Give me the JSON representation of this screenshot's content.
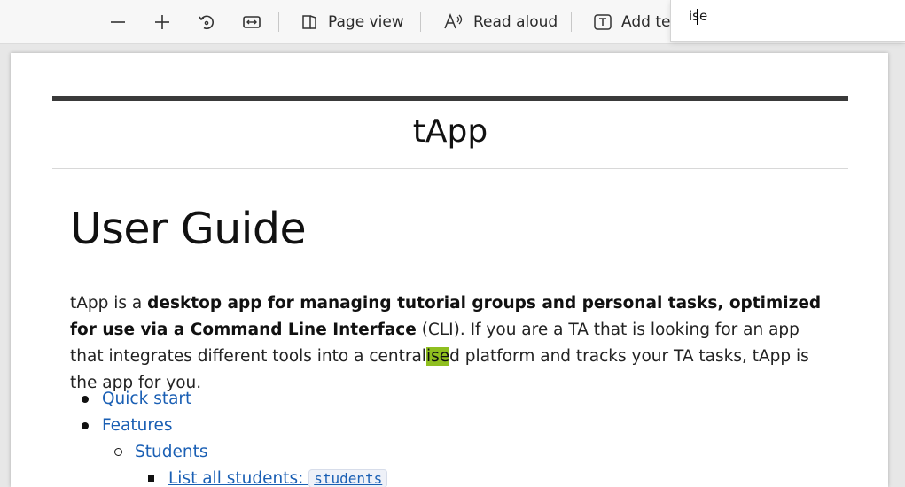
{
  "toolbar": {
    "zoom_out_icon": "minus-icon",
    "zoom_in_icon": "plus-icon",
    "rotate_icon": "rotate-icon",
    "fit_width_icon": "fit-width-icon",
    "page_view_label": "Page view",
    "read_aloud_label": "Read aloud",
    "add_text_label": "Add te"
  },
  "find": {
    "query": "ise"
  },
  "document": {
    "site_title": "tApp",
    "heading": "User Guide",
    "intro": {
      "part1": "tApp is a ",
      "bold1": "desktop app for managing tutorial groups and personal tasks, optimized for use via a Command Line Interface",
      "part2": " (CLI). If you are a TA that is looking for an app that integrates different tools into a central",
      "highlight": "ise",
      "part3": "d platform and tracks your TA tasks, tApp is the app for you."
    },
    "toc": [
      {
        "label": "Quick start",
        "level": 1
      },
      {
        "label": "Features",
        "level": 1
      },
      {
        "label": "Students",
        "level": 2
      },
      {
        "label": "List all students: ",
        "code": "students",
        "level": 3
      }
    ]
  },
  "colors": {
    "link": "#1a5fb4",
    "highlight": "#8fbf1f",
    "rule": "#3a3a3a"
  }
}
